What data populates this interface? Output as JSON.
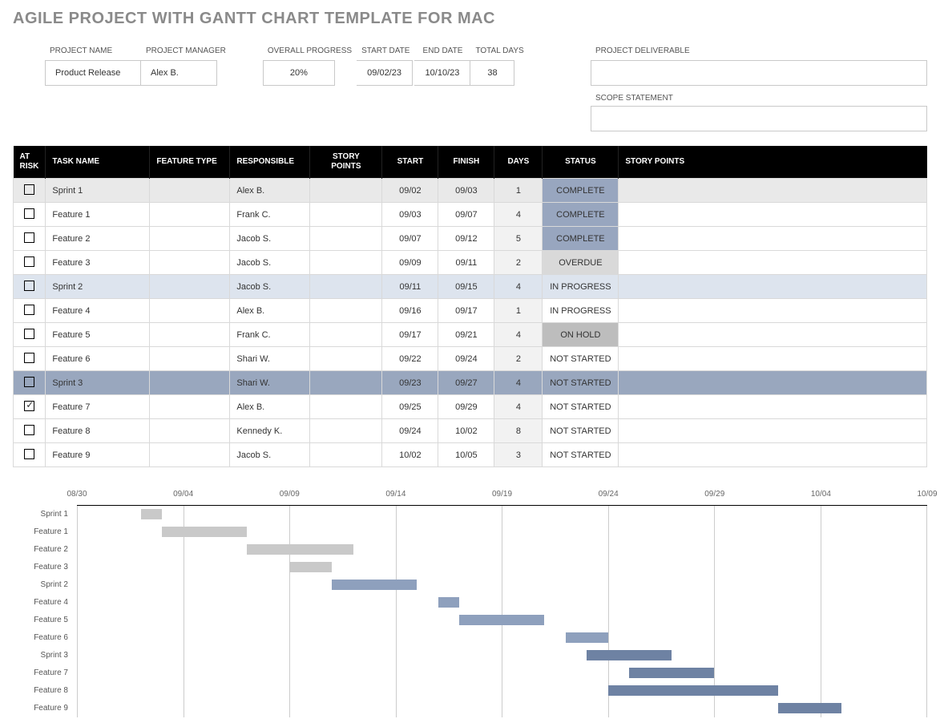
{
  "title": "AGILE PROJECT WITH GANTT CHART TEMPLATE FOR MAC",
  "meta": {
    "project_name_label": "PROJECT NAME",
    "project_name": "Product Release",
    "manager_label": "PROJECT MANAGER",
    "manager": "Alex B.",
    "overall_progress_label": "OVERALL PROGRESS",
    "overall_progress": "20%",
    "start_date_label": "START DATE",
    "start_date": "09/02/23",
    "end_date_label": "END DATE",
    "end_date": "10/10/23",
    "total_days_label": "TOTAL DAYS",
    "total_days": "38",
    "deliverable_label": "PROJECT DELIVERABLE",
    "deliverable": "",
    "scope_label": "SCOPE STATEMENT",
    "scope": ""
  },
  "headers": {
    "at_risk": "AT RISK",
    "task_name": "TASK NAME",
    "feature_type": "FEATURE TYPE",
    "responsible": "RESPONSIBLE",
    "story_points": "STORY POINTS",
    "start": "START",
    "finish": "FINISH",
    "days": "DAYS",
    "status": "STATUS",
    "story_points_bar": "STORY POINTS"
  },
  "rows": [
    {
      "at_risk": false,
      "task": "Sprint 1",
      "feature": "",
      "responsible": "Alex B.",
      "sp": "",
      "start": "09/02",
      "finish": "09/03",
      "days": "1",
      "status": "COMPLETE",
      "row_class": "row-grey"
    },
    {
      "at_risk": false,
      "task": "Feature 1",
      "feature": "",
      "responsible": "Frank C.",
      "sp": "",
      "start": "09/03",
      "finish": "09/07",
      "days": "4",
      "status": "COMPLETE",
      "row_class": ""
    },
    {
      "at_risk": false,
      "task": "Feature 2",
      "feature": "",
      "responsible": "Jacob S.",
      "sp": "",
      "start": "09/07",
      "finish": "09/12",
      "days": "5",
      "status": "COMPLETE",
      "row_class": ""
    },
    {
      "at_risk": false,
      "task": "Feature 3",
      "feature": "",
      "responsible": "Jacob S.",
      "sp": "",
      "start": "09/09",
      "finish": "09/11",
      "days": "2",
      "status": "OVERDUE",
      "row_class": ""
    },
    {
      "at_risk": false,
      "task": "Sprint 2",
      "feature": "",
      "responsible": "Jacob S.",
      "sp": "",
      "start": "09/11",
      "finish": "09/15",
      "days": "4",
      "status": "IN PROGRESS",
      "row_class": "row-blue-light"
    },
    {
      "at_risk": false,
      "task": "Feature 4",
      "feature": "",
      "responsible": "Alex B.",
      "sp": "",
      "start": "09/16",
      "finish": "09/17",
      "days": "1",
      "status": "IN PROGRESS",
      "row_class": ""
    },
    {
      "at_risk": false,
      "task": "Feature 5",
      "feature": "",
      "responsible": "Frank C.",
      "sp": "",
      "start": "09/17",
      "finish": "09/21",
      "days": "4",
      "status": "ON HOLD",
      "row_class": ""
    },
    {
      "at_risk": false,
      "task": "Feature 6",
      "feature": "",
      "responsible": "Shari W.",
      "sp": "",
      "start": "09/22",
      "finish": "09/24",
      "days": "2",
      "status": "NOT STARTED",
      "row_class": ""
    },
    {
      "at_risk": false,
      "task": "Sprint 3",
      "feature": "",
      "responsible": "Shari W.",
      "sp": "",
      "start": "09/23",
      "finish": "09/27",
      "days": "4",
      "status": "NOT STARTED",
      "row_class": "row-blue-mid"
    },
    {
      "at_risk": true,
      "task": "Feature 7",
      "feature": "",
      "responsible": "Alex B.",
      "sp": "",
      "start": "09/25",
      "finish": "09/29",
      "days": "4",
      "status": "NOT STARTED",
      "row_class": ""
    },
    {
      "at_risk": false,
      "task": "Feature 8",
      "feature": "",
      "responsible": "Kennedy K.",
      "sp": "",
      "start": "09/24",
      "finish": "10/02",
      "days": "8",
      "status": "NOT STARTED",
      "row_class": ""
    },
    {
      "at_risk": false,
      "task": "Feature 9",
      "feature": "",
      "responsible": "Jacob S.",
      "sp": "",
      "start": "10/02",
      "finish": "10/05",
      "days": "3",
      "status": "NOT STARTED",
      "row_class": ""
    }
  ],
  "chart_data": {
    "type": "bar",
    "orientation": "horizontal-gantt",
    "x_axis_ticks": [
      "08/30",
      "09/04",
      "09/09",
      "09/14",
      "09/19",
      "09/24",
      "09/29",
      "10/04",
      "10/09"
    ],
    "x_axis_range_days": 40,
    "x_axis_start": "08/30",
    "series": [
      {
        "name": "Sprint 1",
        "start_offset_days": 3,
        "duration_days": 1,
        "color": "grey"
      },
      {
        "name": "Feature 1",
        "start_offset_days": 4,
        "duration_days": 4,
        "color": "grey"
      },
      {
        "name": "Feature 2",
        "start_offset_days": 8,
        "duration_days": 5,
        "color": "grey"
      },
      {
        "name": "Feature 3",
        "start_offset_days": 10,
        "duration_days": 2,
        "color": "grey"
      },
      {
        "name": "Sprint 2",
        "start_offset_days": 12,
        "duration_days": 4,
        "color": "blue-mid"
      },
      {
        "name": "Feature 4",
        "start_offset_days": 17,
        "duration_days": 1,
        "color": "blue-mid"
      },
      {
        "name": "Feature 5",
        "start_offset_days": 18,
        "duration_days": 4,
        "color": "blue-mid"
      },
      {
        "name": "Feature 6",
        "start_offset_days": 23,
        "duration_days": 2,
        "color": "blue-mid"
      },
      {
        "name": "Sprint 3",
        "start_offset_days": 24,
        "duration_days": 4,
        "color": "blue-dark"
      },
      {
        "name": "Feature 7",
        "start_offset_days": 26,
        "duration_days": 4,
        "color": "blue-dark"
      },
      {
        "name": "Feature 8",
        "start_offset_days": 25,
        "duration_days": 8,
        "color": "blue-dark"
      },
      {
        "name": "Feature 9",
        "start_offset_days": 33,
        "duration_days": 3,
        "color": "blue-dark"
      }
    ]
  }
}
